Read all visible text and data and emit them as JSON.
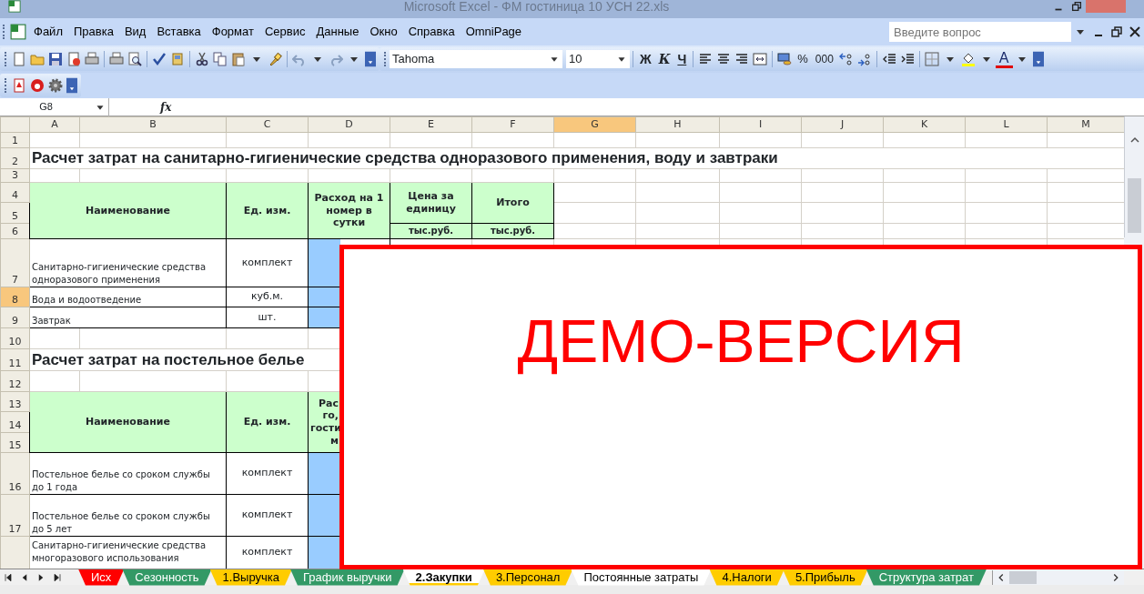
{
  "window": {
    "title": "Microsoft Excel - ФМ гостиница 10 УСН 22.xls"
  },
  "menu": [
    "Файл",
    "Правка",
    "Вид",
    "Вставка",
    "Формат",
    "Сервис",
    "Данные",
    "Окно",
    "Справка",
    "OmniPage"
  ],
  "help_search": {
    "placeholder": "Введите вопрос"
  },
  "formatting": {
    "font": "Tahoma",
    "size": "10",
    "bold": "Ж",
    "italic": "К",
    "underline": "Ч",
    "percent": "%",
    "thousands": "000",
    "font_color": "A"
  },
  "formula_bar": {
    "name_box": "G8",
    "fx": "fx"
  },
  "columns": [
    {
      "label": "A",
      "selected": false
    },
    {
      "label": "B",
      "selected": false
    },
    {
      "label": "C",
      "selected": false
    },
    {
      "label": "D",
      "selected": false
    },
    {
      "label": "E",
      "selected": false
    },
    {
      "label": "F",
      "selected": false
    },
    {
      "label": "G",
      "selected": true
    },
    {
      "label": "H",
      "selected": false
    },
    {
      "label": "I",
      "selected": false
    },
    {
      "label": "J",
      "selected": false
    },
    {
      "label": "K",
      "selected": false
    },
    {
      "label": "L",
      "selected": false
    },
    {
      "label": "M",
      "selected": false
    }
  ],
  "rows": [
    {
      "label": "1",
      "selected": false
    },
    {
      "label": "2",
      "selected": false
    },
    {
      "label": "3",
      "selected": false
    },
    {
      "label": "4",
      "selected": false
    },
    {
      "label": "5",
      "selected": false
    },
    {
      "label": "6",
      "selected": false
    },
    {
      "label": "7",
      "selected": false
    },
    {
      "label": "8",
      "selected": true
    },
    {
      "label": "9",
      "selected": false
    },
    {
      "label": "10",
      "selected": false
    },
    {
      "label": "11",
      "selected": false
    },
    {
      "label": "12",
      "selected": false
    },
    {
      "label": "13",
      "selected": false
    },
    {
      "label": "14",
      "selected": false
    },
    {
      "label": "15",
      "selected": false
    },
    {
      "label": "16",
      "selected": false
    },
    {
      "label": "17",
      "selected": false
    }
  ],
  "table_1": {
    "title": "Расчет затрат на санитарно-гигиенические средства одноразового применения, воду и завтраки",
    "header": {
      "name": "Наименование",
      "unit": "Ед. изм.",
      "consumption": "Расход  на 1 номер в сутки",
      "price": "Цена за единицу",
      "total": "Итого",
      "price_unit": "тыс.руб.",
      "total_unit": "тыс.руб."
    },
    "items": [
      {
        "name": "Санитарно-гигиенические средства одноразового применения",
        "unit": "комплект"
      },
      {
        "name": "Вода и водоотведение",
        "unit": "куб.м."
      },
      {
        "name": "Завтрак",
        "unit": "шт."
      }
    ]
  },
  "table_2": {
    "title": "Расчет затрат на постельное белье",
    "header": {
      "name": "Наименование",
      "unit": "Ед. изм.",
      "consumption_lines": [
        "Рас",
        "го,",
        "гости",
        "м"
      ]
    },
    "items": [
      {
        "name": "Постельное белье со сроком службы до 1 года",
        "unit": "комплект"
      },
      {
        "name": "Постельное белье со сроком службы до 5 лет",
        "unit": "комплект"
      },
      {
        "name": "Санитарно-гигиенические средства многоразового использования",
        "unit": "комплект"
      }
    ]
  },
  "demo_banner": {
    "text": "ДЕМО-ВЕРСИЯ"
  },
  "sheet_tabs": [
    {
      "label": "Исх",
      "color": "#ff0000",
      "selected": false
    },
    {
      "label": "Сезонность",
      "color": "#339966",
      "selected": false
    },
    {
      "label": "1.Выручка",
      "color": "#ffcc00",
      "selected": false
    },
    {
      "label": "График выручки",
      "color": "#339966",
      "selected": false
    },
    {
      "label": "2.Закупки",
      "color": "#ffcc00",
      "selected": true
    },
    {
      "label": "3.Персонал",
      "color": "#ffcc00",
      "selected": false
    },
    {
      "label": "Постоянные затраты",
      "color": "#ffffff",
      "selected": false
    },
    {
      "label": "4.Налоги",
      "color": "#ffcc00",
      "selected": false
    },
    {
      "label": "5.Прибыль",
      "color": "#ffcc00",
      "selected": false
    },
    {
      "label": "Структура затрат",
      "color": "#339966",
      "selected": false
    }
  ]
}
